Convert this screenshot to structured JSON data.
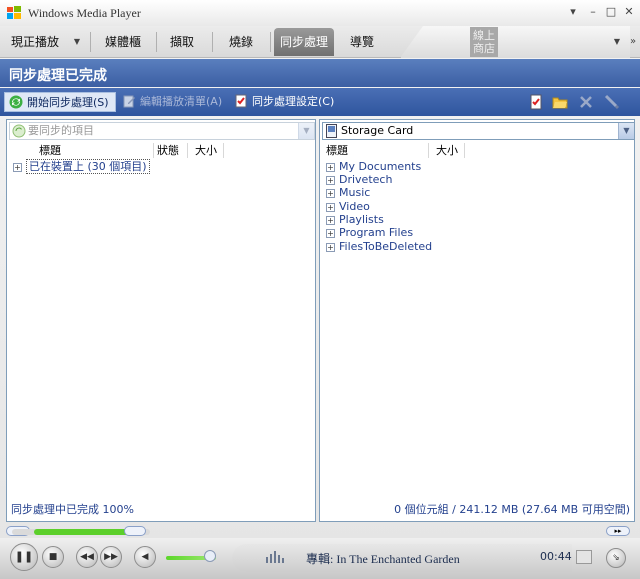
{
  "window": {
    "title": "Windows Media Player",
    "controls": {
      "minimize": "–",
      "maximize": "□",
      "close": "✕"
    }
  },
  "nav": {
    "tabs": [
      "現正播放",
      "媒體櫃",
      "擷取",
      "燒錄",
      "同步處理",
      "導覽"
    ],
    "active": "同步處理",
    "store_label": "線上商店"
  },
  "header": {
    "status": "同步處理已完成"
  },
  "toolbar": {
    "start_sync": "開始同步處理(S)",
    "edit_playlist": "編輯播放清單(A)",
    "sync_settings": "同步處理設定(C)"
  },
  "left_pane": {
    "select_placeholder": "要同步的項目",
    "columns": [
      "標題",
      "狀態",
      "大小"
    ],
    "rows": [
      "已在裝置上 (30 個項目)"
    ],
    "status": "同步處理中已完成 100%"
  },
  "right_pane": {
    "device": "Storage Card",
    "columns": [
      "標題",
      "大小"
    ],
    "rows": [
      "My Documents",
      "Drivetech",
      "Music",
      "Video",
      "Playlists",
      "Program Files",
      "FilesToBeDeleted"
    ],
    "status": "0 個位元組 / 241.12 MB (27.64 MB 可用空間)"
  },
  "player": {
    "now_playing": "專輯: In The Enchanted Garden",
    "time": "00:44"
  },
  "colors": {
    "accent_blue": "#3b5ea3",
    "link_blue": "#24418e",
    "progress_green": "#5ccf2a"
  }
}
